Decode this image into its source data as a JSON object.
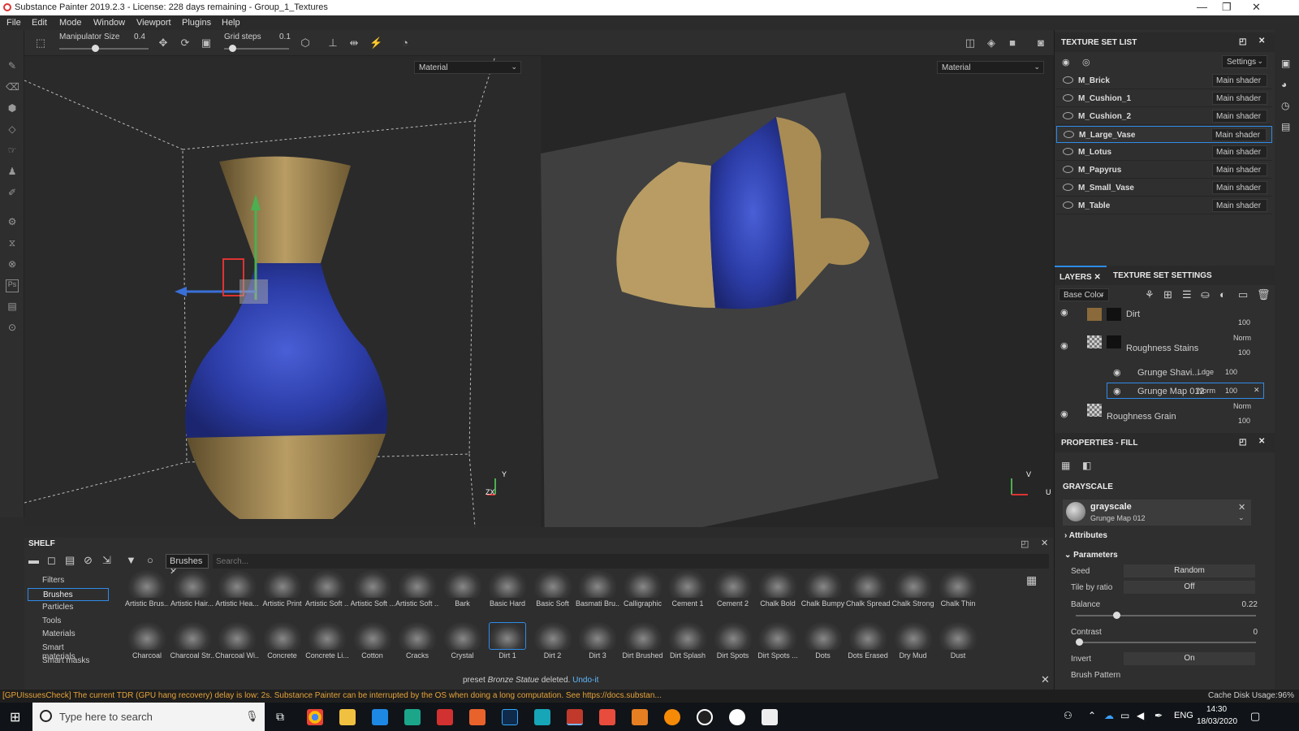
{
  "window": {
    "title": "Substance Painter 2019.2.3 - License: 228 days remaining - Group_1_Textures"
  },
  "menu": [
    "File",
    "Edit",
    "Mode",
    "Window",
    "Viewport",
    "Plugins",
    "Help"
  ],
  "toolbar": {
    "manip_label": "Manipulator Size",
    "manip_value": "0.4",
    "grid_label": "Grid steps",
    "grid_value": "0.1"
  },
  "viewport": {
    "left_mode": "Material",
    "right_mode": "Material",
    "axis_y": "Y",
    "axis_zx": "ZX",
    "axis_v": "V",
    "axis_u": "U"
  },
  "texture_set_list": {
    "title": "TEXTURE SET LIST",
    "settings_label": "Settings",
    "items": [
      {
        "name": "M_Brick",
        "shader": "Main shader"
      },
      {
        "name": "M_Cushion_1",
        "shader": "Main shader"
      },
      {
        "name": "M_Cushion_2",
        "shader": "Main shader"
      },
      {
        "name": "M_Large_Vase",
        "shader": "Main shader"
      },
      {
        "name": "M_Lotus",
        "shader": "Main shader"
      },
      {
        "name": "M_Papyrus",
        "shader": "Main shader"
      },
      {
        "name": "M_Small_Vase",
        "shader": "Main shader"
      },
      {
        "name": "M_Table",
        "shader": "Main shader"
      }
    ]
  },
  "layers": {
    "tab_layers": "LAYERS",
    "tab_tss": "TEXTURE SET SETTINGS",
    "channel": "Base Color",
    "items": [
      {
        "name": "Dirt",
        "opacity": "100",
        "blend": ""
      },
      {
        "name": "Roughness Stains",
        "opacity": "100",
        "blend": "Norm"
      },
      {
        "name": "Grunge Shavi...",
        "opacity": "100",
        "blend": "Ldge"
      },
      {
        "name": "Grunge Map 012",
        "opacity": "100",
        "blend": "Norm"
      },
      {
        "name": "Roughness Grain",
        "opacity": "100",
        "blend": "Norm"
      }
    ]
  },
  "properties": {
    "title": "PROPERTIES - FILL",
    "section": "GRAYSCALE",
    "res_name": "grayscale",
    "res_sub": "Grunge Map 012",
    "attributes": "Attributes",
    "parameters": "Parameters",
    "seed_label": "Seed",
    "seed_value": "Random",
    "tile_label": "Tile by ratio",
    "tile_value": "Off",
    "balance_label": "Balance",
    "balance_value": "0.22",
    "contrast_label": "Contrast",
    "contrast_value": "0",
    "invert_label": "Invert",
    "invert_value": "On",
    "brush_label": "Brush Pattern"
  },
  "shelf": {
    "title": "SHELF",
    "filter_tag": "Brushes",
    "search_placeholder": "Search...",
    "categories": [
      "Filters",
      "Brushes",
      "Particles",
      "Tools",
      "Materials",
      "Smart materials",
      "Smart masks"
    ],
    "row1": [
      "Artistic Brus...",
      "Artistic Hair...",
      "Artistic Hea...",
      "Artistic Print",
      "Artistic Soft ...",
      "Artistic Soft ...",
      "Artistic Soft ...",
      "Bark",
      "Basic Hard",
      "Basic Soft",
      "Basmati Bru...",
      "Calligraphic",
      "Cement 1",
      "Cement 2",
      "Chalk Bold",
      "Chalk Bumpy",
      "Chalk Spread",
      "Chalk Strong",
      "Chalk Thin"
    ],
    "row2": [
      "Charcoal",
      "Charcoal Str...",
      "Charcoal Wi...",
      "Concrete",
      "Concrete Li...",
      "Cotton",
      "Cracks",
      "Crystal",
      "Dirt 1",
      "Dirt 2",
      "Dirt 3",
      "Dirt Brushed",
      "Dirt Splash",
      "Dirt Spots",
      "Dirt Spots ...",
      "Dots",
      "Dots Erased",
      "Dry Mud",
      "Dust"
    ],
    "notice_pre": "preset",
    "notice_item": "Bronze Statue",
    "notice_post": "deleted.",
    "undo": "Undo-it"
  },
  "status": {
    "message": "[GPUIssuesCheck] The current TDR (GPU hang recovery) delay is low: 2s. Substance Painter can be interrupted by the OS when doing a long computation. See https://docs.substan...",
    "cache": "Cache Disk Usage:",
    "cache_value": "96%"
  },
  "taskbar": {
    "search_placeholder": "Type here to search",
    "lang": "ENG",
    "time": "14:30",
    "date": "18/03/2020"
  }
}
